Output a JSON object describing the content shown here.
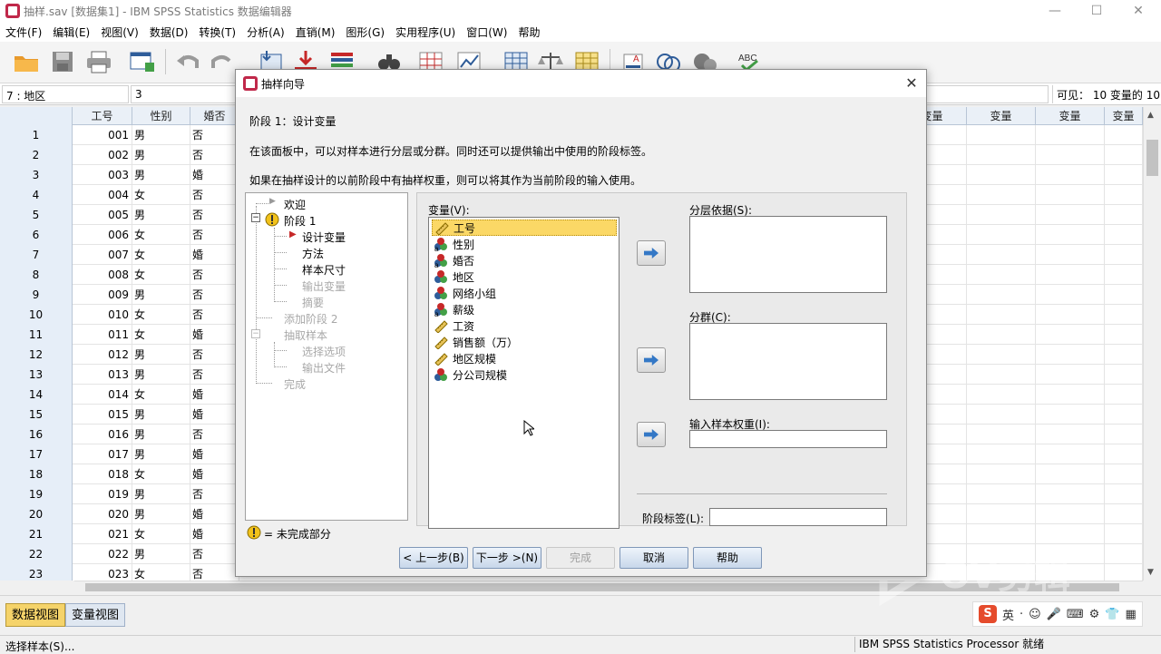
{
  "window": {
    "title": "抽样.sav [数据集1] - IBM SPSS Statistics 数据编辑器",
    "controls": [
      "—",
      "☐",
      "✕"
    ]
  },
  "menu": [
    "文件(F)",
    "编辑(E)",
    "视图(V)",
    "数据(D)",
    "转换(T)",
    "分析(A)",
    "直销(M)",
    "图形(G)",
    "实用程序(U)",
    "窗口(W)",
    "帮助"
  ],
  "toolbar_icons": [
    "open-folder-icon",
    "save-icon",
    "print-icon",
    "dialog-recall-icon",
    "undo-icon",
    "redo-icon",
    "goto-case-icon",
    "goto-variable-icon",
    "variables-icon",
    "find-icon",
    "insert-cases-icon",
    "insert-variable-icon",
    "split-file-icon",
    "weight-cases-icon",
    "select-cases-icon",
    "value-labels-icon",
    "use-sets-icon",
    "show-all-icon",
    "spelling-icon"
  ],
  "cell_editor": {
    "ref": "7 : 地区",
    "value": "3",
    "visible": "可见： 10 变量的 10"
  },
  "grid": {
    "columns": [
      "工号",
      "性别",
      "婚否"
    ],
    "empty_col_label": "变量",
    "empty_col_last": "变量",
    "rows": [
      {
        "n": "1",
        "id": "001",
        "sex": "男",
        "mar": "否"
      },
      {
        "n": "2",
        "id": "002",
        "sex": "男",
        "mar": "否"
      },
      {
        "n": "3",
        "id": "003",
        "sex": "男",
        "mar": "婚"
      },
      {
        "n": "4",
        "id": "004",
        "sex": "女",
        "mar": "否"
      },
      {
        "n": "5",
        "id": "005",
        "sex": "男",
        "mar": "否"
      },
      {
        "n": "6",
        "id": "006",
        "sex": "女",
        "mar": "否"
      },
      {
        "n": "7",
        "id": "007",
        "sex": "女",
        "mar": "婚"
      },
      {
        "n": "8",
        "id": "008",
        "sex": "女",
        "mar": "否"
      },
      {
        "n": "9",
        "id": "009",
        "sex": "男",
        "mar": "否"
      },
      {
        "n": "10",
        "id": "010",
        "sex": "女",
        "mar": "否"
      },
      {
        "n": "11",
        "id": "011",
        "sex": "女",
        "mar": "婚"
      },
      {
        "n": "12",
        "id": "012",
        "sex": "男",
        "mar": "否"
      },
      {
        "n": "13",
        "id": "013",
        "sex": "男",
        "mar": "否"
      },
      {
        "n": "14",
        "id": "014",
        "sex": "女",
        "mar": "婚"
      },
      {
        "n": "15",
        "id": "015",
        "sex": "男",
        "mar": "婚"
      },
      {
        "n": "16",
        "id": "016",
        "sex": "男",
        "mar": "否"
      },
      {
        "n": "17",
        "id": "017",
        "sex": "男",
        "mar": "婚"
      },
      {
        "n": "18",
        "id": "018",
        "sex": "女",
        "mar": "婚"
      },
      {
        "n": "19",
        "id": "019",
        "sex": "男",
        "mar": "否"
      },
      {
        "n": "20",
        "id": "020",
        "sex": "男",
        "mar": "婚"
      },
      {
        "n": "21",
        "id": "021",
        "sex": "女",
        "mar": "婚"
      },
      {
        "n": "22",
        "id": "022",
        "sex": "男",
        "mar": "否"
      },
      {
        "n": "23",
        "id": "023",
        "sex": "女",
        "mar": "否"
      }
    ]
  },
  "view_tabs": [
    "数据视图",
    "变量视图"
  ],
  "ime": {
    "logo": "S",
    "lang": "英",
    "glyphs": [
      "·",
      "☺",
      "🎤",
      "⌨",
      "⚙",
      "👕",
      "▦"
    ]
  },
  "status": {
    "left": "选择样本(S)...",
    "right": "IBM SPSS Statistics Processor 就绪"
  },
  "dialog": {
    "title": "抽样向导",
    "close": "✕",
    "stage_heading": "阶段 1：设计变量",
    "desc1": "在该面板中，可以对样本进行分层或分群。同时还可以提供输出中使用的阶段标签。",
    "desc2": "如果在抽样设计的以前阶段中有抽样权重，则可以将其作为当前阶段的输入使用。",
    "tree": {
      "welcome": "欢迎",
      "stage1": "阶段 1",
      "design_vars": "设计变量",
      "method": "方法",
      "sample_size": "样本尺寸",
      "output_vars": "输出变量",
      "summary": "摘要",
      "add_stage2": "添加阶段 2",
      "draw_sample": "抽取样本",
      "select_options": "选择选项",
      "output_files": "输出文件",
      "finish": "完成"
    },
    "legend": "= 未完成部分",
    "variables_label": "变量(V):",
    "variables": [
      {
        "name": "工号",
        "type": "scale",
        "selected": true
      },
      {
        "name": "性别",
        "type": "nominal-string",
        "selected": false
      },
      {
        "name": "婚否",
        "type": "nominal-string",
        "selected": false
      },
      {
        "name": "地区",
        "type": "nominal",
        "selected": false
      },
      {
        "name": "网络小组",
        "type": "nominal",
        "selected": false
      },
      {
        "name": "薪级",
        "type": "nominal-string",
        "selected": false
      },
      {
        "name": "工资",
        "type": "scale",
        "selected": false
      },
      {
        "name": "销售额（万）",
        "type": "scale",
        "selected": false
      },
      {
        "name": "地区规模",
        "type": "scale",
        "selected": false
      },
      {
        "name": "分公司规模",
        "type": "nominal",
        "selected": false
      }
    ],
    "strata_label": "分层依据(S):",
    "clusters_label": "分群(C):",
    "weight_label": "输入样本权重(I):",
    "stage_label": "阶段标签(L):",
    "stage_label_value": "",
    "buttons": {
      "back": "< 上一步(B)",
      "next": "下一步 >(N)",
      "finish": "完成",
      "cancel": "取消",
      "help": "帮助"
    }
  },
  "watermark": "OV剪辑",
  "colors": {
    "selected_highlight": "#fbd866",
    "active_tab": "#f5d36a",
    "arrow_blue": "#3478c6",
    "warning_yellow": "#f2c21b"
  }
}
